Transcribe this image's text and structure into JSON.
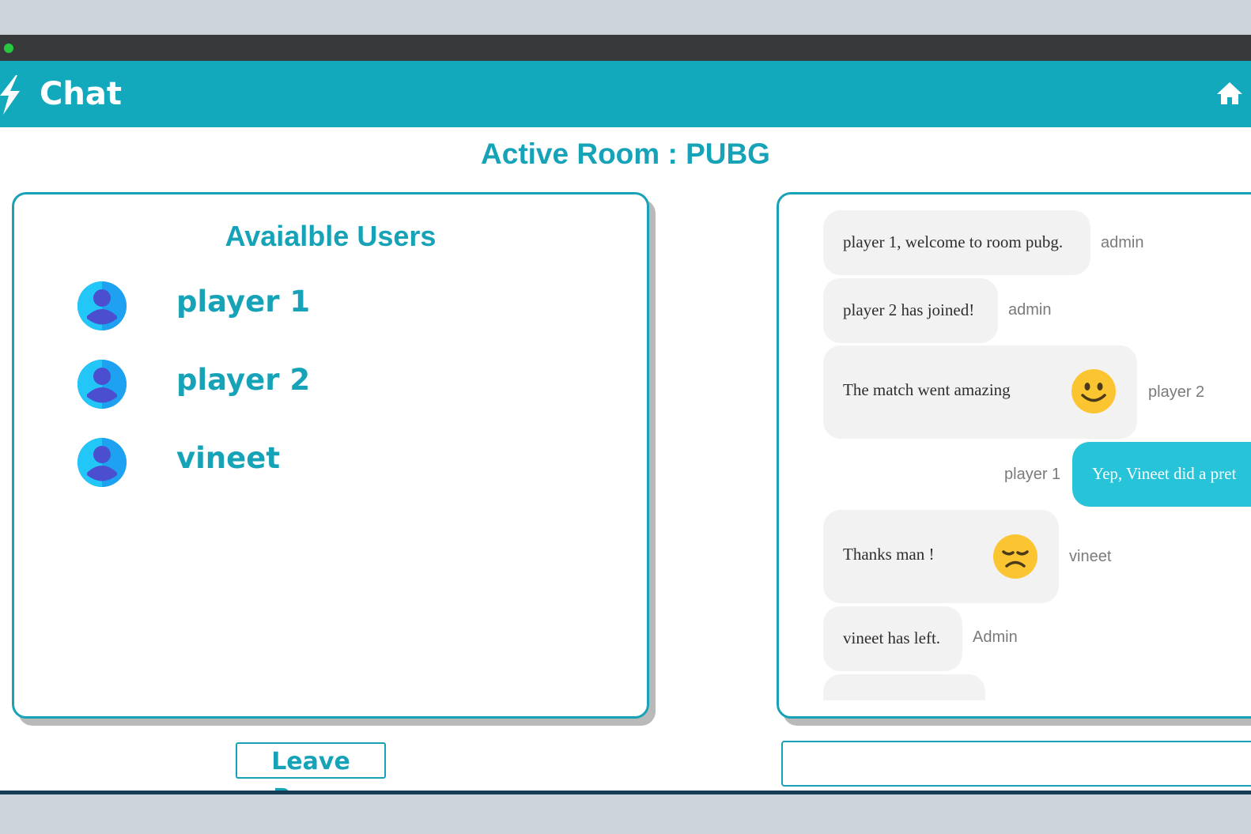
{
  "app": {
    "brand": "Chat",
    "brand_icon": "lightning-bolt-icon",
    "home_icon": "home-icon"
  },
  "room": {
    "title": "Active Room : PUBG"
  },
  "users_panel": {
    "title": "Avaialble Users",
    "users": [
      {
        "name": "player 1"
      },
      {
        "name": "player 2"
      },
      {
        "name": "vineet"
      }
    ]
  },
  "leave_button": {
    "label": "Leave Room"
  },
  "messages": [
    {
      "text": "player 1, welcome to room pubg.",
      "sender": "admin"
    },
    {
      "text": "player 2 has joined!",
      "sender": "admin"
    },
    {
      "text": "The match went amazing",
      "sender": "player 2",
      "emoji": "smiling-face-emoji"
    },
    {
      "text": "Yep, Vineet did a pret",
      "sender": "player 1",
      "mine": true
    },
    {
      "text": "Thanks man !",
      "sender": "vineet",
      "emoji": "disappointed-face-emoji"
    },
    {
      "text": "vineet has left.",
      "sender": "Admin"
    }
  ],
  "message_input": {
    "value": "",
    "placeholder": ""
  },
  "colors": {
    "accent": "#12a9bd",
    "own_bubble": "#26c3d9",
    "other_bubble": "#f2f2f2"
  }
}
